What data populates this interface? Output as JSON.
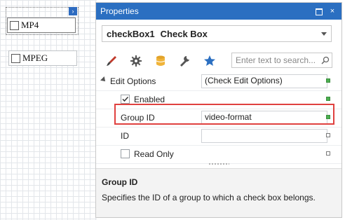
{
  "canvas": {
    "checkbox1_label": "MP4",
    "checkbox2_label": "MPEG",
    "smart_tag_glyph": "›"
  },
  "panel": {
    "title": "Properties",
    "title_buttons": {
      "restore": "restore-icon",
      "close": "×"
    },
    "selector": {
      "name": "checkBox1",
      "type": "Check Box"
    },
    "toolbar_icons": [
      "brush-icon",
      "gear-icon",
      "database-icon",
      "wrench-icon",
      "star-icon"
    ],
    "search": {
      "placeholder": "Enter text to search...",
      "value": ""
    },
    "rows": [
      {
        "name": "Edit Options",
        "value": "(Check Edit Options)",
        "marker": "filled"
      },
      {
        "name": "Enabled",
        "checked": true,
        "marker": "filled"
      },
      {
        "name": "Group ID",
        "value": "video-format",
        "marker": "filled"
      },
      {
        "name": "ID",
        "value": "",
        "marker": "empty"
      },
      {
        "name": "Read Only",
        "checked": false,
        "marker": "empty"
      }
    ],
    "description": {
      "title": "Group ID",
      "text": "Specifies the ID of a group to which a check box belongs."
    },
    "colors": {
      "accent": "#2b6fc1",
      "highlight": "#e0413f",
      "marker_green": "#4caf50"
    }
  }
}
